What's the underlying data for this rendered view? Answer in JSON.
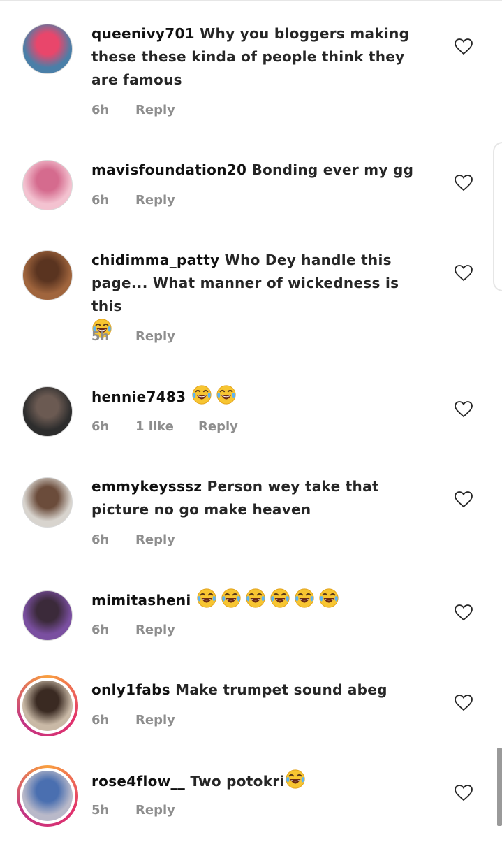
{
  "comments": [
    {
      "username": "queenivy701",
      "text": "Why you bloggers making these these kinda of people think they are famous",
      "emojis": 0,
      "time": "6h",
      "likes": "",
      "reply": "Reply",
      "avatar_colors": [
        "#4a7fa8",
        "#e9466b"
      ]
    },
    {
      "username": "mavisfoundation20",
      "text": "Bonding ever my gg",
      "emojis": 0,
      "time": "6h",
      "likes": "",
      "reply": "Reply",
      "avatar_colors": [
        "#f3c2d0",
        "#d56b8e"
      ]
    },
    {
      "username": "chidimma_patty",
      "text": "Who Dey handle this page... What manner of wickedness is this",
      "emojis": 1,
      "time": "5h",
      "likes": "",
      "reply": "Reply",
      "avatar_colors": [
        "#a0653d",
        "#5a3420"
      ]
    },
    {
      "username": "hennie7483",
      "text": "",
      "emojis": 2,
      "time": "6h",
      "likes": "1 like",
      "reply": "Reply",
      "avatar_colors": [
        "#2d2d2d",
        "#6b5a52"
      ]
    },
    {
      "username": "emmykeysssz",
      "text": "Person wey take that picture no go make heaven",
      "emojis": 0,
      "time": "6h",
      "likes": "",
      "reply": "Reply",
      "avatar_colors": [
        "#d8d4ce",
        "#6b4c3b"
      ]
    },
    {
      "username": "mimitasheni",
      "text": "",
      "emojis": 6,
      "time": "6h",
      "likes": "",
      "reply": "Reply",
      "avatar_colors": [
        "#7a4fa0",
        "#3b2a3a"
      ]
    },
    {
      "username": "only1fabs",
      "text": "Make trumpet sound abeg",
      "emojis": 0,
      "time": "6h",
      "likes": "",
      "reply": "Reply",
      "avatar_colors": [
        "#c9b9a6",
        "#3a2a22"
      ]
    },
    {
      "username": "rose4flow__",
      "text": "Two potokri",
      "emojis": 1,
      "time": "5h",
      "likes": "",
      "reply": "Reply",
      "avatar_colors": [
        "#b9b9c9",
        "#4a6fb0"
      ]
    }
  ],
  "icons": {
    "like": "heart-outline-icon",
    "emoji": "face-with-tears-of-joy-emoji"
  },
  "colors": {
    "username": "#111111",
    "body_text": "#262626",
    "meta_text": "#8e8e8e",
    "story_ring": [
      "#f9a03f",
      "#e1306c",
      "#c13584"
    ]
  }
}
